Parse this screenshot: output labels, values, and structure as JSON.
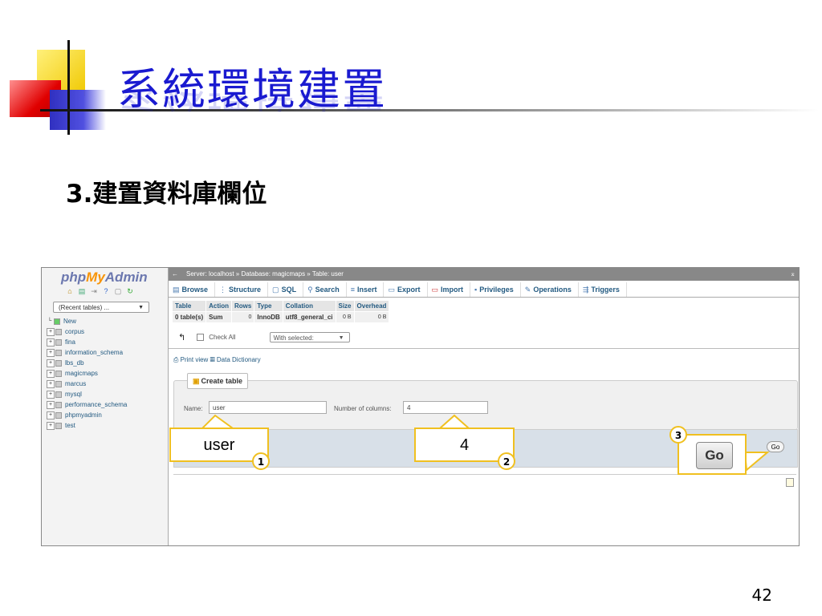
{
  "slide": {
    "title": "系統環境建置",
    "subtitle": "3.建置資料庫欄位",
    "page_number": "42"
  },
  "pma": {
    "logo": {
      "php": "php",
      "my": "My",
      "admin": "Admin"
    },
    "recent_tables": "(Recent tables) ...",
    "databases": [
      "New",
      "corpus",
      "fina",
      "information_schema",
      "lbs_db",
      "magicmaps",
      "marcus",
      "mysql",
      "performance_schema",
      "phpmyadmin",
      "test"
    ],
    "breadcrumb": "Server: localhost » Database: magicmaps » Table: user",
    "tabs": [
      "Browse",
      "Structure",
      "SQL",
      "Search",
      "Insert",
      "Export",
      "Import",
      "Privileges",
      "Operations",
      "Triggers"
    ],
    "table": {
      "headers": [
        "Table",
        "Action",
        "Rows",
        "Type",
        "Collation",
        "Size",
        "Overhead"
      ],
      "row": [
        "0 table(s)",
        "Sum",
        "0",
        "InnoDB",
        "utf8_general_ci",
        "0 B",
        "0 B"
      ]
    },
    "check_all": "Check All",
    "with_selected": "With selected:",
    "print_view": "Print view",
    "data_dictionary": "Data Dictionary",
    "create_table": "Create table",
    "name_label": "Name:",
    "name_value": "user",
    "columns_label": "Number of columns:",
    "columns_value": "4",
    "go_small": "Go"
  },
  "annotations": {
    "callout_1": "user",
    "callout_2": "4",
    "num_1": "1",
    "num_2": "2",
    "num_3": "3",
    "go_big": "Go",
    "accent_color": "#f0c020"
  }
}
